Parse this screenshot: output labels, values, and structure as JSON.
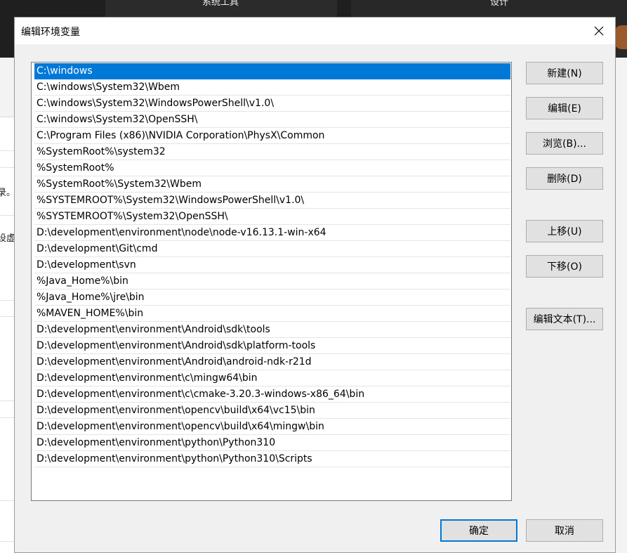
{
  "background": {
    "top_text_1": "系统工具",
    "top_text_2": "设计",
    "left_text_1": "录。",
    "left_text_2": "设虚"
  },
  "dialog": {
    "title": "编辑环境变量"
  },
  "path_list": [
    "C:\\windows",
    "C:\\windows\\System32\\Wbem",
    "C:\\windows\\System32\\WindowsPowerShell\\v1.0\\",
    "C:\\windows\\System32\\OpenSSH\\",
    "C:\\Program Files (x86)\\NVIDIA Corporation\\PhysX\\Common",
    "%SystemRoot%\\system32",
    "%SystemRoot%",
    "%SystemRoot%\\System32\\Wbem",
    "%SYSTEMROOT%\\System32\\WindowsPowerShell\\v1.0\\",
    "%SYSTEMROOT%\\System32\\OpenSSH\\",
    "D:\\development\\environment\\node\\node-v16.13.1-win-x64",
    "D:\\development\\Git\\cmd",
    "D:\\development\\svn",
    "%Java_Home%\\bin",
    "%Java_Home%\\jre\\bin",
    "%MAVEN_HOME%\\bin",
    "D:\\development\\environment\\Android\\sdk\\tools",
    "D:\\development\\environment\\Android\\sdk\\platform-tools",
    "D:\\development\\environment\\Android\\android-ndk-r21d",
    "D:\\development\\environment\\c\\mingw64\\bin",
    "D:\\development\\environment\\c\\cmake-3.20.3-windows-x86_64\\bin",
    "D:\\development\\environment\\opencv\\build\\x64\\vc15\\bin",
    "D:\\development\\environment\\opencv\\build\\x64\\mingw\\bin",
    "D:\\development\\environment\\python\\Python310",
    "D:\\development\\environment\\python\\Python310\\Scripts"
  ],
  "selected_index": 0,
  "buttons": {
    "new": "新建(N)",
    "edit": "编辑(E)",
    "browse": "浏览(B)...",
    "delete": "删除(D)",
    "move_up": "上移(U)",
    "move_down": "下移(O)",
    "edit_text": "编辑文本(T)...",
    "ok": "确定",
    "cancel": "取消"
  },
  "colors": {
    "selection": "#0078d7",
    "primary_border": "#0078d7"
  }
}
